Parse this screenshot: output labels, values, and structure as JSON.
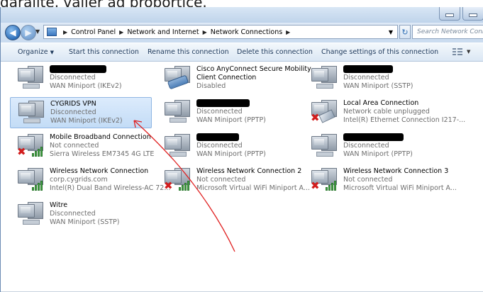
{
  "caption_text": "daralite. valjer ad proportice.",
  "address_bar": {
    "crumbs": [
      "Control Panel",
      "Network and Internet",
      "Network Connections"
    ],
    "search_placeholder": "Search Network Connections"
  },
  "toolbar": {
    "organize": "Organize",
    "start": "Start this connection",
    "rename": "Rename this connection",
    "delete": "Delete this connection",
    "change": "Change settings of this connection"
  },
  "connections": [
    {
      "name": "",
      "redacted": true,
      "status": "Disconnected",
      "device": "WAN Miniport (IKEv2)",
      "icon": "wan-miniport-icon"
    },
    {
      "name": "Cisco AnyConnect Secure Mobility",
      "name2": "Client Connection",
      "status": "Disabled",
      "device": "",
      "icon": "cisco-anyconnect-icon"
    },
    {
      "name": "",
      "redacted": true,
      "status": "Disconnected",
      "device": "WAN Miniport (SSTP)",
      "icon": "wan-miniport-icon"
    },
    {
      "name": "CYGRIDS VPN",
      "status": "Disconnected",
      "device": "WAN Miniport (IKEv2)",
      "icon": "wan-miniport-icon",
      "selected": true
    },
    {
      "name": "",
      "redacted": true,
      "status": "Disconnected",
      "device": "WAN Miniport (PPTP)",
      "icon": "wan-miniport-icon"
    },
    {
      "name": "Local Area Connection",
      "status": "Network cable unplugged",
      "device": "Intel(R) Ethernet Connection I217-...",
      "icon": "ethernet-unplugged-icon"
    },
    {
      "name": "Mobile Broadband Connection",
      "status": "Not connected",
      "device": "Sierra Wireless EM7345 4G LTE",
      "icon": "mobile-broadband-icon"
    },
    {
      "name": "",
      "redacted": true,
      "status": "Disconnected",
      "device": "WAN Miniport (PPTP)",
      "icon": "wan-miniport-icon"
    },
    {
      "name": "",
      "redacted": true,
      "status": "Disconnected",
      "device": "WAN Miniport (PPTP)",
      "icon": "wan-miniport-icon"
    },
    {
      "name": "Wireless Network Connection",
      "status": "corp.cygrids.com",
      "device": "Intel(R) Dual Band Wireless-AC 72...",
      "icon": "wireless-connected-icon"
    },
    {
      "name": "Wireless Network Connection 2",
      "status": "Not connected",
      "device": "Microsoft Virtual WiFi Miniport A...",
      "icon": "wireless-disconnected-icon"
    },
    {
      "name": "Wireless Network Connection 3",
      "status": "Not connected",
      "device": "Microsoft Virtual WiFi Miniport A...",
      "icon": "wireless-disconnected-icon"
    },
    {
      "name": "Witre",
      "status": "Disconnected",
      "device": "WAN Miniport (SSTP)",
      "icon": "wan-miniport-icon"
    }
  ],
  "colors": {
    "annotation_arrow": "#e02020",
    "selection": "#c3dcf6"
  }
}
